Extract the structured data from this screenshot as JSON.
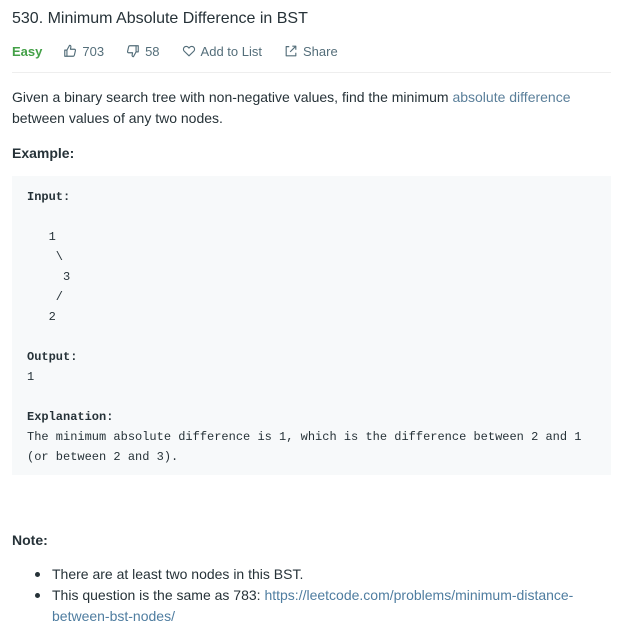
{
  "problem": {
    "title": "530. Minimum Absolute Difference in BST",
    "difficulty": "Easy",
    "likes": "703",
    "dislikes": "58",
    "add_to_list_label": "Add to List",
    "share_label": "Share"
  },
  "description": {
    "text_before": "Given a binary search tree with non-negative values, find the minimum ",
    "link_text": "absolute difference",
    "text_after": " between values of any two nodes."
  },
  "example": {
    "label": "Example:",
    "input_label": "Input:",
    "tree_lines": [
      "",
      "   1",
      "    \\",
      "     3",
      "    /",
      "   2"
    ],
    "output_label": "Output:",
    "output_value": "1",
    "explanation_label": "Explanation:",
    "explanation_lines": [
      "The minimum absolute difference is 1, which is the difference between 2 and 1",
      "(or between 2 and 3)."
    ]
  },
  "note": {
    "label": "Note:",
    "item1": "There are at least two nodes in this BST.",
    "item2_prefix": "This question is the same as 783: ",
    "item2_link": "https://leetcode.com/problems/minimum-distance-between-bst-nodes/"
  },
  "icons": {
    "like": "thumbs-up-icon",
    "dislike": "thumbs-down-icon",
    "add_to_list": "heart-icon",
    "share": "share-icon"
  },
  "colors": {
    "easy": "#43a047",
    "link": "#4f7da0",
    "code_background": "#f7f9fa"
  }
}
